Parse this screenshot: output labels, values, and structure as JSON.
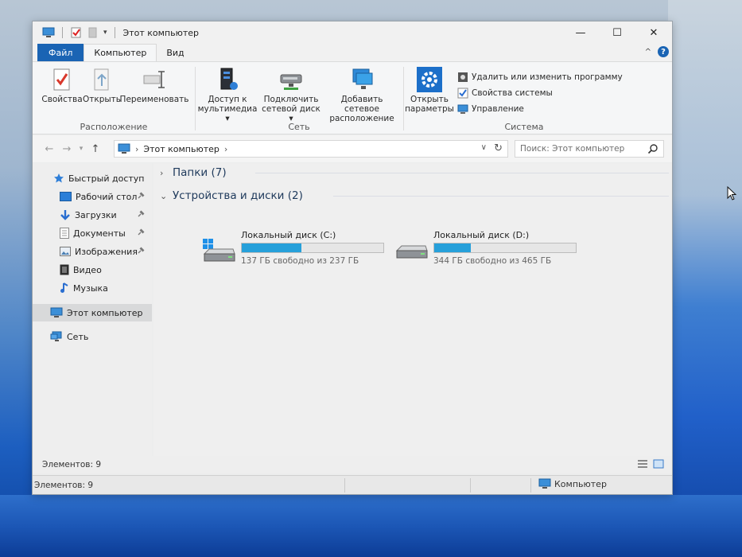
{
  "window": {
    "title": "Этот компьютер",
    "minimize": "—",
    "maximize": "☐",
    "close": "✕"
  },
  "tabs": {
    "file": "Файл",
    "computer": "Компьютер",
    "view": "Вид"
  },
  "ribbon": {
    "location": {
      "label": "Расположение",
      "properties": "Свойства",
      "open": "Открыть",
      "rename": "Переименовать"
    },
    "network": {
      "label": "Сеть",
      "media_access_1": "Доступ к",
      "media_access_2": "мультимедиа ▾",
      "map_drive_1": "Подключить",
      "map_drive_2": "сетевой диск ▾",
      "add_location_1": "Добавить сетевое",
      "add_location_2": "расположение"
    },
    "system": {
      "label": "Система",
      "open_settings_1": "Открыть",
      "open_settings_2": "параметры",
      "uninstall": "Удалить или изменить программу",
      "system_properties": "Свойства системы",
      "manage": "Управление"
    }
  },
  "address": {
    "path": "Этот компьютер",
    "search_placeholder": "Поиск: Этот компьютер"
  },
  "nav": {
    "quick_access": "Быстрый доступ",
    "desktop": "Рабочий стол",
    "downloads": "Загрузки",
    "documents": "Документы",
    "pictures": "Изображения",
    "videos": "Видео",
    "music": "Музыка",
    "this_pc": "Этот компьютер",
    "network": "Сеть"
  },
  "content": {
    "folders_header": "Папки (7)",
    "devices_header": "Устройства и диски (2)",
    "drives": [
      {
        "name": "Локальный диск (C:)",
        "free_text": "137 ГБ свободно из 237 ГБ",
        "used_fraction": 0.42
      },
      {
        "name": "Локальный диск (D:)",
        "free_text": "344 ГБ свободно из 465 ГБ",
        "used_fraction": 0.26
      }
    ]
  },
  "status": {
    "items_inner": "Элементов: 9",
    "items_outer": "Элементов: 9",
    "zone": "Компьютер"
  },
  "colors": {
    "file_tab": "#1a64b4",
    "drive_fill": "#26a0da",
    "desktop_blue": "#1d5fc0"
  }
}
